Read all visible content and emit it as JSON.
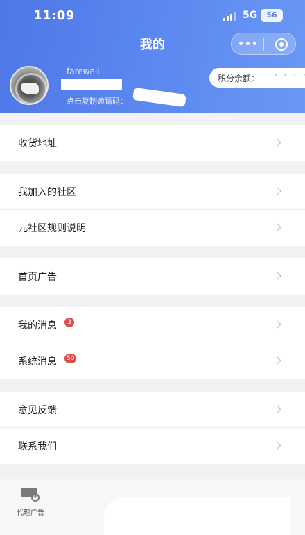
{
  "status_bar": {
    "time": "11:09",
    "network": "5G",
    "battery": "56"
  },
  "header": {
    "title": "我的",
    "username": "farewell",
    "invite_label": "点击复制邀请码：",
    "points_label": "积分余额：",
    "points_value": "· · · ·"
  },
  "groups": [
    {
      "items": [
        {
          "label": "收货地址"
        }
      ]
    },
    {
      "items": [
        {
          "label": "我加入的社区"
        },
        {
          "label": "元社区规则说明"
        }
      ]
    },
    {
      "items": [
        {
          "label": "首页广告"
        }
      ]
    },
    {
      "items": [
        {
          "label": "我的消息",
          "badge": "3"
        },
        {
          "label": "系统消息",
          "badge": "50"
        }
      ]
    },
    {
      "items": [
        {
          "label": "意见反馈"
        },
        {
          "label": "联系我们"
        }
      ]
    }
  ],
  "tabbar": {
    "agent_ad_label": "代理广告"
  },
  "colors": {
    "header_gradient_start": "#4e78e6",
    "header_gradient_end": "#6a98f5",
    "badge": "#e34b4b"
  }
}
